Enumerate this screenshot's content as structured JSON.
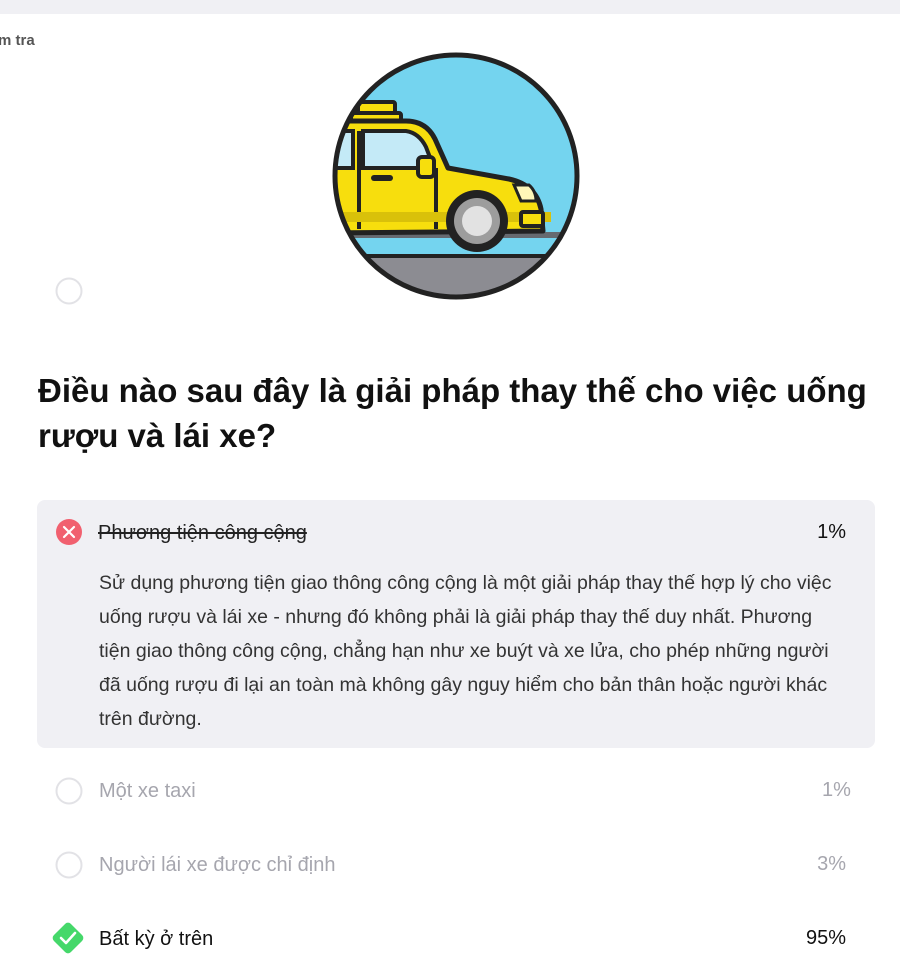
{
  "breadcrumb": "m tra",
  "question": "Điều nào sau đây là giải pháp thay thế cho việc uống rượu và lái xe?",
  "options": [
    {
      "label": "Phương tiện công cộng",
      "percent": "1%",
      "status": "wrong",
      "explanation": "Sử dụng phương tiện giao thông công cộng là một giải pháp thay thế hợp lý cho việc uống rượu và lái xe - nhưng đó không phải là giải pháp thay thế duy nhất. Phương tiện giao thông công cộng, chẳng hạn như xe buýt và xe lửa, cho phép những người đã uống rượu đi lại an toàn mà không gây nguy hiểm cho bản thân hoặc người khác trên đường."
    },
    {
      "label": "Một xe taxi",
      "percent": "1%",
      "status": "unselected"
    },
    {
      "label": "Người lái xe được chỉ định",
      "percent": "3%",
      "status": "unselected"
    },
    {
      "label": "Bất kỳ ở trên",
      "percent": "95%",
      "status": "correct"
    }
  ],
  "icons": {
    "wrong": "x-circle-icon",
    "unselected": "empty-radio-icon",
    "correct": "check-diamond-icon",
    "hero": "taxi-illustration"
  },
  "colors": {
    "wrong": "#f1606f",
    "correct": "#45d86a",
    "selected_bg": "#f0f0f4",
    "sky": "#74d4ef",
    "taxi": "#f7de0d"
  }
}
